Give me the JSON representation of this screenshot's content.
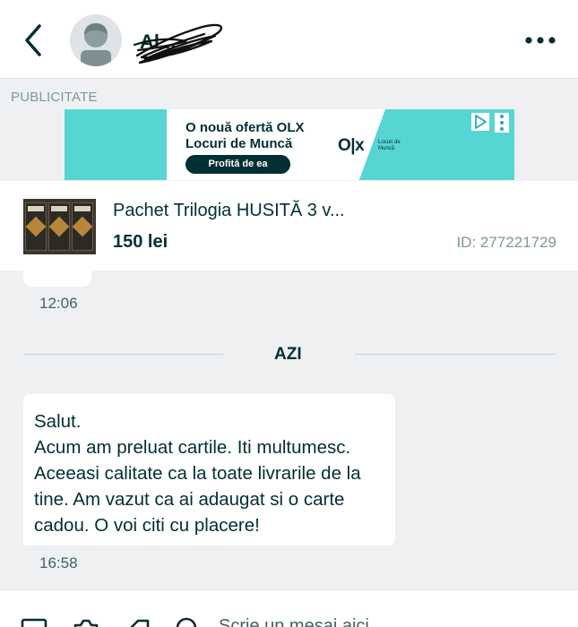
{
  "header": {
    "contact_name": "Al...",
    "back_icon": "chevron-left-icon",
    "more_icon": "more-horizontal-icon"
  },
  "ad": {
    "label": "PUBLICITATE",
    "title": "O nouă ofertă OLX Locuri de Muncă",
    "cta": "Profită de ea",
    "logo": "O|x",
    "logo_sub": "Locuri de Muncă",
    "colors": {
      "background": "#57d5d3",
      "text": "#002f34"
    }
  },
  "listing": {
    "title": "Pachet Trilogia HUSITĂ 3 v...",
    "price": "150 lei",
    "id": "ID: 277221729"
  },
  "messages": {
    "earlier_time": "12:06",
    "day_divider": "AZI",
    "latest": {
      "text": "Salut.\nAcum am preluat cartile. Iti multumesc. Aceeasi calitate ca la toate livrarile de la tine. Am vazut ca ai adaugat si o carte cadou. O voi citi cu placere!",
      "time": "16:58"
    }
  },
  "composer": {
    "placeholder": "Scrie un mesaj aici...",
    "icons": [
      "image-icon",
      "camera-icon",
      "tag-icon",
      "location-icon"
    ]
  }
}
